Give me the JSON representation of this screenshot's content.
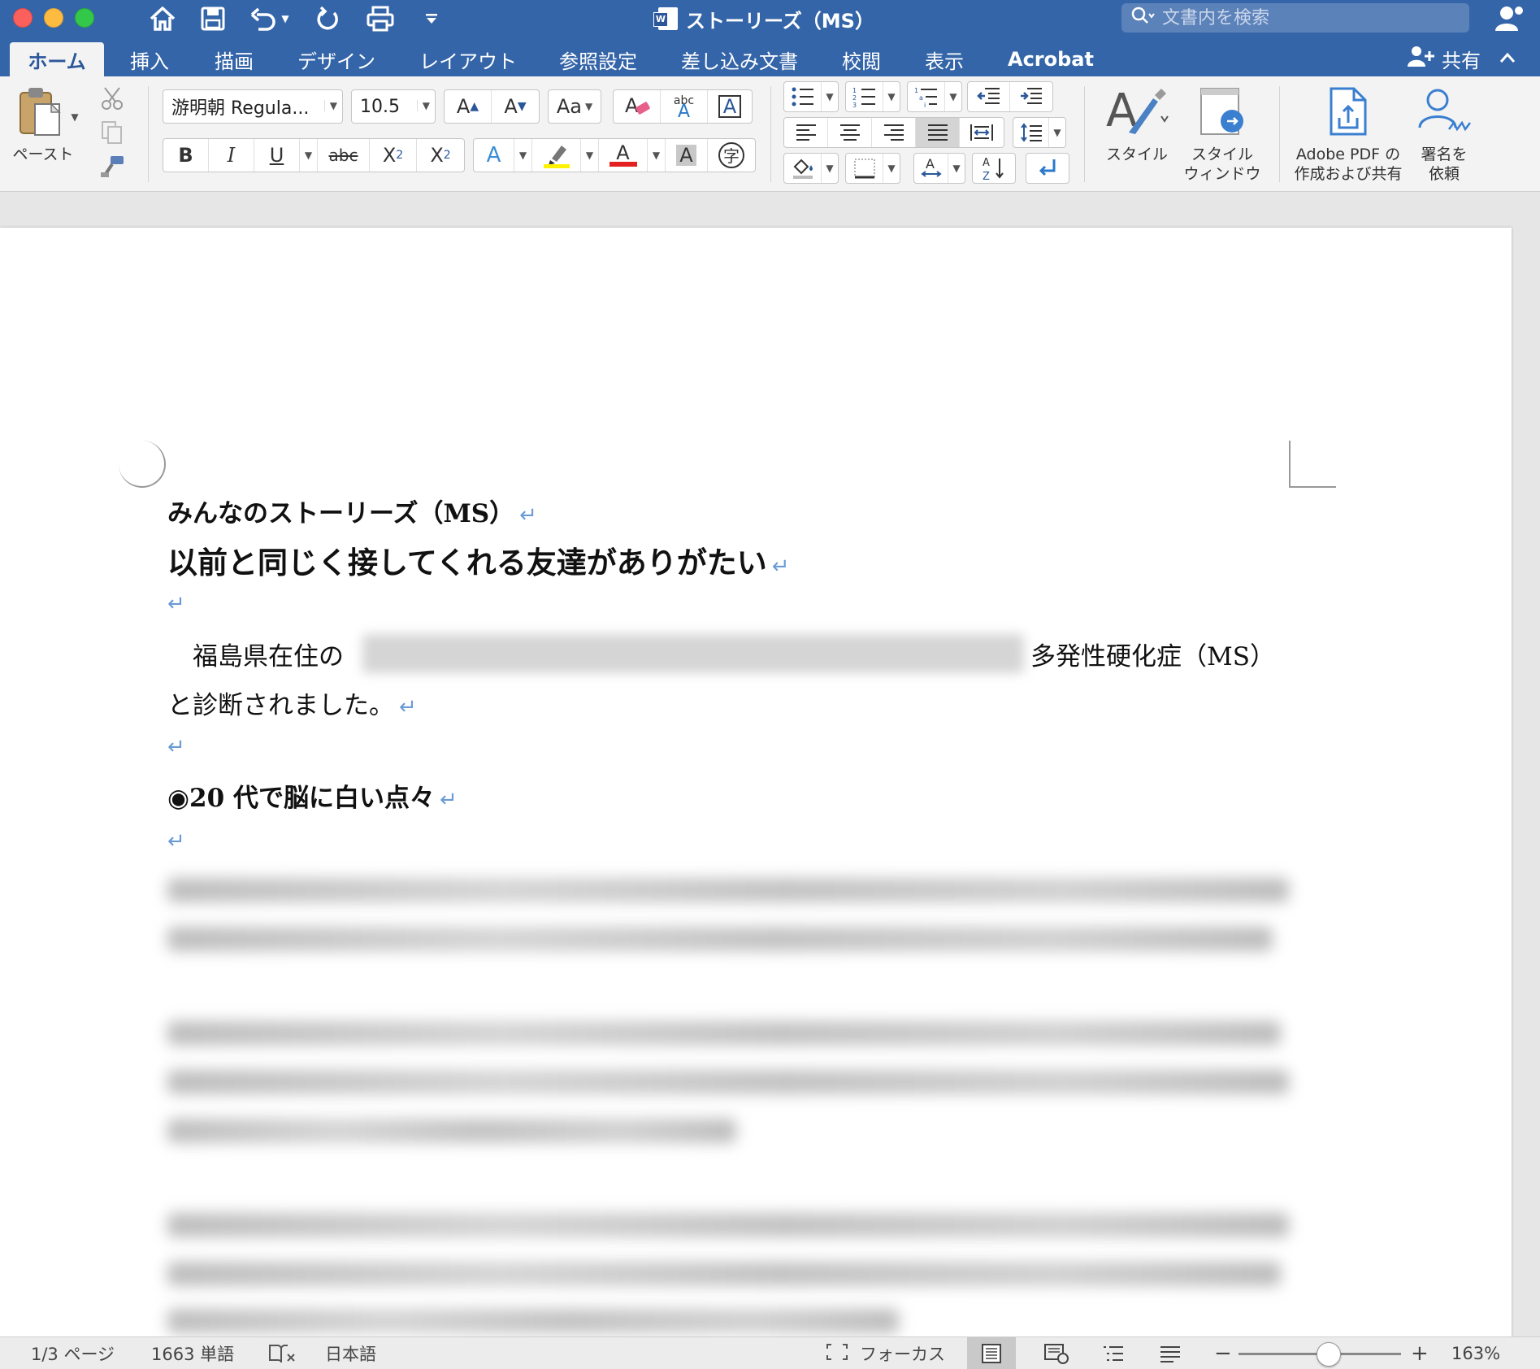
{
  "window": {
    "title": "ストーリーズ（MS）",
    "search_placeholder": "文書内を検索"
  },
  "tabs": [
    "ホーム",
    "挿入",
    "描画",
    "デザイン",
    "レイアウト",
    "参照設定",
    "差し込み文書",
    "校閲",
    "表示",
    "Acrobat"
  ],
  "share_label": "共有",
  "ribbon": {
    "paste_label": "ペースト",
    "font_name": "游明朝 Regula...",
    "font_size": "10.5",
    "bold": "B",
    "italic": "I",
    "underline": "U",
    "strike": "abc",
    "styles_label": "スタイル",
    "styles_pane_label_1": "スタイル",
    "styles_pane_label_2": "ウィンドウ",
    "adobe_label_1": "Adobe PDF の",
    "adobe_label_2": "作成および共有",
    "sign_label_1": "署名を",
    "sign_label_2": "依頼"
  },
  "document": {
    "heading1": "みんなのストーリーズ（MS）",
    "heading2": "以前と同じく接してくれる友達がありがたい",
    "para1_start": "　福島県在住の",
    "para1_end": "多発性硬化症（MS）",
    "para1_line2": "と診断されました。",
    "section_heading": "◉20 代で脳に白い点々"
  },
  "statusbar": {
    "page": "1/3 ページ",
    "words": "1663 単語",
    "language": "日本語",
    "focus": "フォーカス",
    "zoom": "163%"
  },
  "colors": {
    "titlebar": "#3465a8",
    "accent": "#2b579a",
    "pilcrow": "#6b9bd6"
  }
}
